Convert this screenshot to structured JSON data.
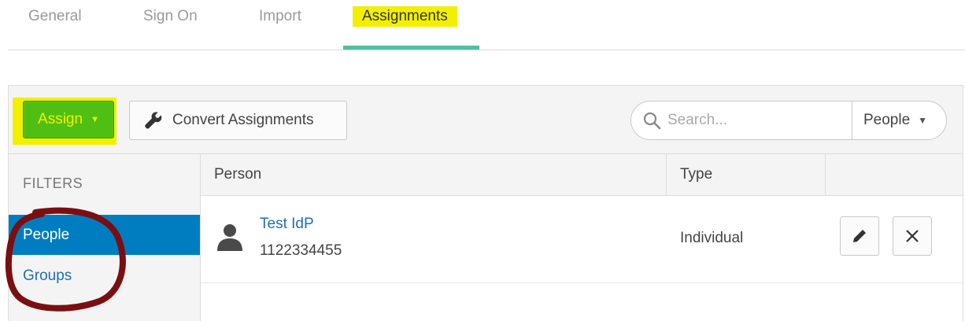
{
  "tabs": [
    {
      "label": "General"
    },
    {
      "label": "Sign On"
    },
    {
      "label": "Import"
    },
    {
      "label": "Assignments",
      "active": true
    }
  ],
  "toolbar": {
    "assign_label": "Assign",
    "convert_label": "Convert Assignments",
    "search_placeholder": "Search...",
    "search_scope": "People"
  },
  "filters": {
    "title": "FILTERS",
    "items": [
      {
        "label": "People",
        "selected": true
      },
      {
        "label": "Groups",
        "selected": false
      }
    ]
  },
  "table": {
    "columns": [
      "Person",
      "Type",
      ""
    ],
    "rows": [
      {
        "name": "Test IdP",
        "id": "1122334455",
        "type": "Individual"
      }
    ]
  },
  "colors": {
    "accent_tab": "#4dc1a1",
    "assign_button": "#4fbf14",
    "highlight": "#f2f000",
    "selected_filter": "#007dc1",
    "link": "#1d6fb5",
    "annotation_circle": "#7a0f12"
  },
  "icons": [
    "wrench-icon",
    "search-icon",
    "person-icon",
    "pencil-icon",
    "close-icon",
    "caret-down-icon"
  ]
}
